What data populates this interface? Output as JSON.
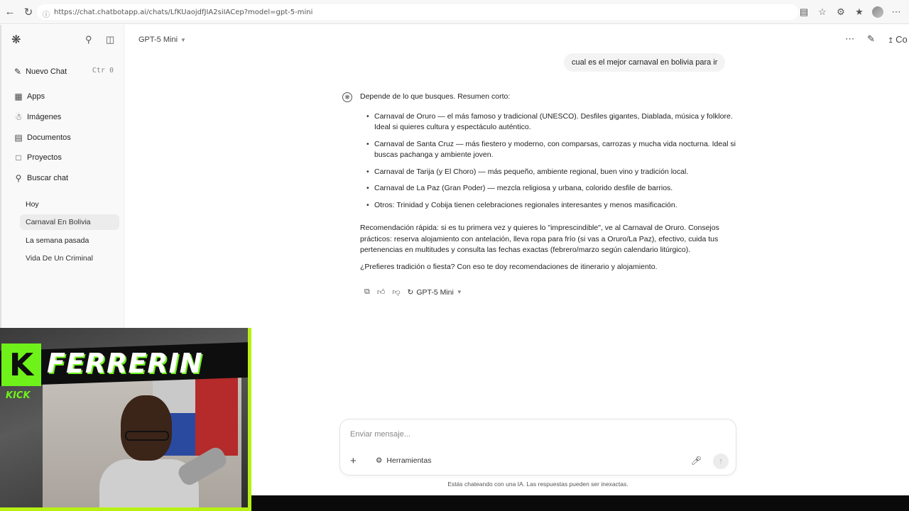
{
  "browser": {
    "url": "https://chat.chatbotapp.ai/chats/LfKUaojdfJIA2siIACep?model=gpt-5-mini"
  },
  "sidebar": {
    "new_chat": {
      "label": "Nuevo Chat",
      "shortcut": "Ctr 0"
    },
    "menu": [
      {
        "label": "Apps",
        "icon": "apps-grid-icon"
      },
      {
        "label": "Imágenes",
        "icon": "image-icon"
      },
      {
        "label": "Documentos",
        "icon": "document-icon"
      },
      {
        "label": "Proyectos",
        "icon": "folder-icon"
      },
      {
        "label": "Buscar chat",
        "icon": "search-icon"
      }
    ],
    "history": {
      "today_label": "Hoy",
      "today_items": [
        "Carnaval En Bolivia"
      ],
      "last_week_label": "La semana pasada",
      "last_week_items": [
        "Vida De Un Criminal"
      ]
    }
  },
  "header": {
    "model": "GPT-5 Mini",
    "share_label": "Co"
  },
  "conversation": {
    "user_message": "cual es el mejor carnaval en bolivia para ir",
    "assistant": {
      "intro": "Depende de lo que busques. Resumen corto:",
      "bullets": [
        "Carnaval de Oruro — el más famoso y tradicional (UNESCO). Desfiles gigantes, Diablada, música y folklore. Ideal si quieres cultura y espectáculo auténtico.",
        "Carnaval de Santa Cruz — más fiestero y moderno, con comparsas, carrozas y mucha vida nocturna. Ideal si buscas pachanga y ambiente joven.",
        "Carnaval de Tarija (y El Choro) — más pequeño, ambiente regional, buen vino y tradición local.",
        "Carnaval de La Paz (Gran Poder) — mezcla religiosa y urbana, colorido desfile de barrios.",
        "Otros: Trinidad y Cobija tienen celebraciones regionales interesantes y menos masificación."
      ],
      "tips": "Recomendación rápida: si es tu primera vez y quieres lo \"imprescindible\", ve al Carnaval de Oruro. Consejos prácticos: reserva alojamiento con antelación, lleva ropa para frío (si vas a Oruro/La Paz), efectivo, cuida tus pertenencias en multitudes y consulta las fechas exactas (febrero/marzo según calendario litúrgico).",
      "question": "¿Prefieres tradición o fiesta? Con eso te doy recomendaciones de itinerario y alojamiento.",
      "model_label": "GPT-5 Mini"
    }
  },
  "composer": {
    "placeholder": "Enviar mensaje...",
    "tools_label": "Herramientas",
    "disclaimer": "Estás chateando con una IA. Las respuestas pueden ser inexactas."
  },
  "webcam": {
    "logo_letter": "K",
    "platform": "KICK",
    "streamer": "FERRERIN"
  }
}
